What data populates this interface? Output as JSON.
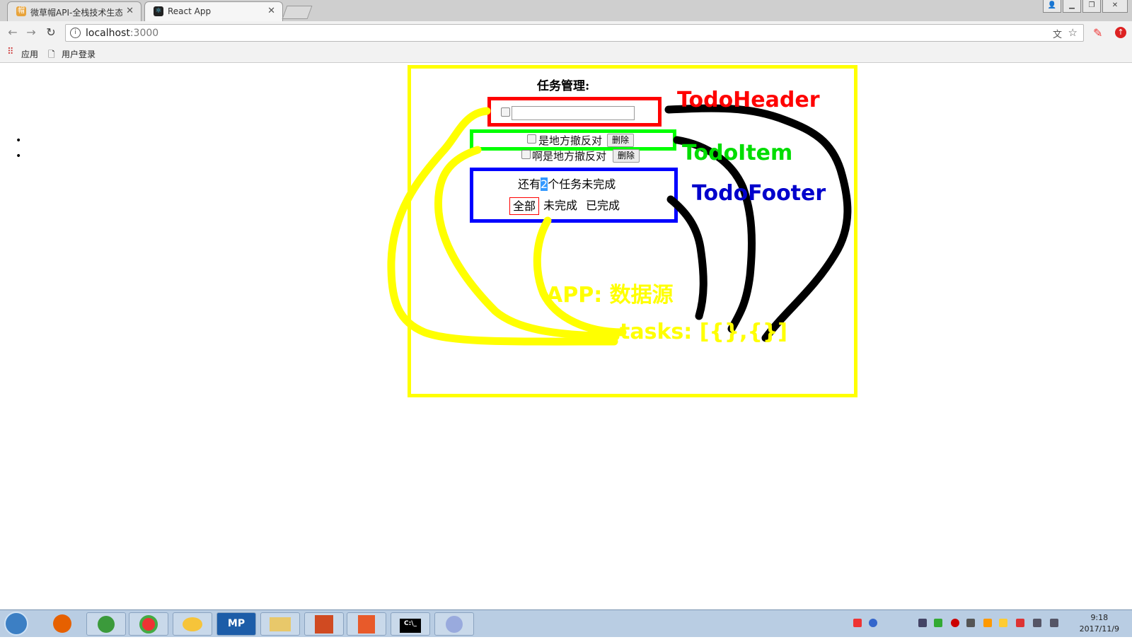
{
  "browser": {
    "tabs": [
      {
        "title": "微草帽API-全栈技术生态",
        "active": false
      },
      {
        "title": "React App",
        "active": true
      }
    ],
    "address": {
      "host": "localhost",
      "port": ":3000"
    },
    "bookmarks": [
      {
        "label": "应用"
      },
      {
        "label": "用户登录"
      }
    ]
  },
  "page": {
    "title": "任务管理:",
    "todos": [
      {
        "text": "是地方撤反对",
        "delete_label": "删除",
        "done": false
      },
      {
        "text": "啊是地方撤反对",
        "delete_label": "删除",
        "done": false
      }
    ],
    "footer": {
      "prefix": "还有",
      "count": "2",
      "suffix": "个任务未完成"
    },
    "filters": [
      {
        "label": "全部",
        "selected": true
      },
      {
        "label": "未完成",
        "selected": false
      },
      {
        "label": "已完成",
        "selected": false
      }
    ]
  },
  "annotations": {
    "header": {
      "text": "TodoHeader",
      "color": "#ff0000"
    },
    "item": {
      "text": "TodoItem",
      "color": "#00dd00"
    },
    "footer": {
      "text": "TodoFooter",
      "color": "#0000cc"
    },
    "app": {
      "text": "APP: 数据源",
      "color": "#ffff00"
    },
    "tasks": {
      "text": "tasks: [{},{}]",
      "color": "#ffff00"
    }
  },
  "taskbar": {
    "apps": [
      "firefox-icon",
      "ie-icon",
      "chrome-icon",
      "messenger-icon",
      "mp-icon",
      "explorer-icon",
      "powerpoint-icon",
      "hbuilder-icon",
      "cmd-icon",
      "paint-icon"
    ],
    "mp_label": "MP",
    "cmd_label": "C:\\_",
    "clock": {
      "time": "9:18",
      "date": "2017/11/9"
    }
  },
  "colors": {
    "app_border": "#ffff00",
    "header_border": "#ff0000",
    "item_border": "#00ff00",
    "footer_border": "#0000ff"
  }
}
